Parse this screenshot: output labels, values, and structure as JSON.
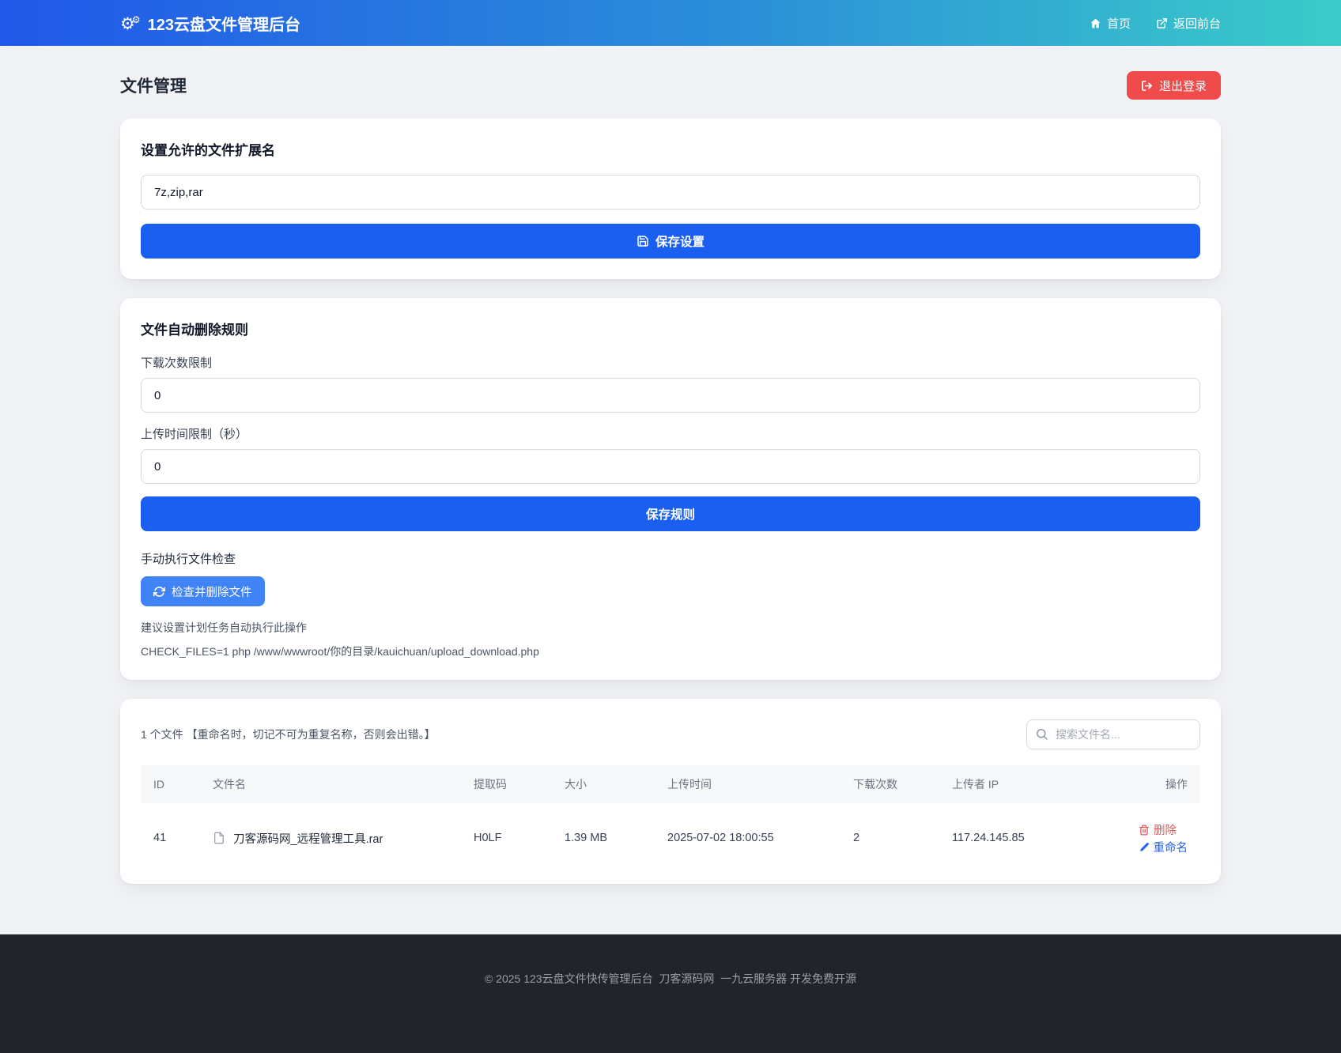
{
  "navbar": {
    "brand": "123云盘文件管理后台",
    "links": [
      {
        "label": "首页"
      },
      {
        "label": "返回前台"
      }
    ]
  },
  "icons": {
    "gear": "⚙"
  },
  "page": {
    "title": "文件管理",
    "logout_label": "退出登录"
  },
  "extension_card": {
    "heading": "设置允许的文件扩展名",
    "input_value": "7z,zip,rar",
    "save_label": "保存设置"
  },
  "rules_card": {
    "heading": "文件自动删除规则",
    "download_limit_label": "下载次数限制",
    "download_limit_value": "0",
    "upload_time_label": "上传时间限制（秒）",
    "upload_time_value": "0",
    "save_label": "保存规则",
    "manual_check_label": "手动执行文件检查",
    "check_button_label": "检查并删除文件",
    "hint": "建议设置计划任务自动执行此操作",
    "command": "CHECK_FILES=1 php /www/wwwroot/你的目录/kauichuan/upload_download.php"
  },
  "files_card": {
    "summary": "1 个文件 【重命名时，切记不可为重复名称，否则会出错。】",
    "search_placeholder": "搜索文件名...",
    "table": {
      "headers": [
        "ID",
        "文件名",
        "提取码",
        "大小",
        "上传时间",
        "下载次数",
        "上传者 IP",
        "操作"
      ],
      "rows": [
        {
          "id": "41",
          "filename": "刀客源码网_远程管理工具.rar",
          "code": "H0LF",
          "size": "1.39 MB",
          "uploaded": "2025-07-02 18:00:55",
          "downloads": "2",
          "ip": "117.24.145.85",
          "delete_label": "删除",
          "rename_label": "重命名"
        }
      ]
    }
  },
  "footer": {
    "text": "© 2025 123云盘文件快传管理后台  刀客源码网  一九云服务器 开发免费开源"
  },
  "colors": {
    "navbar_gradient_start": "#2158e9",
    "navbar_gradient_end": "#3accc9",
    "primary_blue": "#1a5ff0",
    "check_button_blue": "#3f83f6",
    "logout_red": "#f04b4b",
    "delete_red": "#e25555",
    "rename_blue": "#2563eb",
    "footer_bg": "#212529",
    "page_bg": "#f0f2f5"
  }
}
